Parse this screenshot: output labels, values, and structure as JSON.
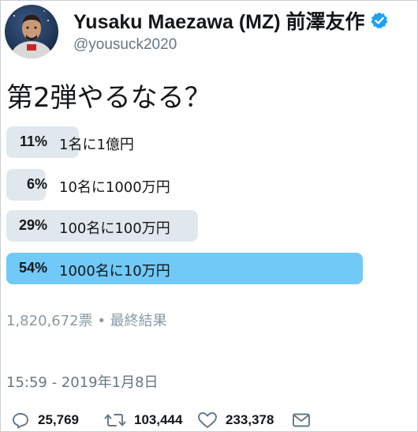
{
  "author": {
    "name": "Yusaku Maezawa (MZ) 前澤友作",
    "handle": "@yousuck2020",
    "verified": true,
    "avatar_icon": "astronaut-avatar"
  },
  "tweet": {
    "text": "第2弾やるなる？"
  },
  "poll": {
    "options": [
      {
        "percent_label": "11%",
        "percent": 11,
        "label": "1名に1億円",
        "winner": false
      },
      {
        "percent_label": "6%",
        "percent": 6,
        "label": "10名に1000万円",
        "winner": false
      },
      {
        "percent_label": "29%",
        "percent": 29,
        "label": "100名に100万円",
        "winner": false
      },
      {
        "percent_label": "54%",
        "percent": 54,
        "label": "1000名に10万円",
        "winner": true
      }
    ],
    "summary": "1,820,672票 • 最終結果"
  },
  "timestamp": "15:59 - 2019年1月8日",
  "actions": {
    "reply_icon": "reply-icon",
    "reply_count": "25,769",
    "retweet_icon": "retweet-icon",
    "retweet_count": "103,444",
    "like_icon": "heart-icon",
    "like_count": "233,378",
    "message_icon": "envelope-icon"
  },
  "colors": {
    "bar": "#e1e8ed",
    "winner_bar": "#71c9f8",
    "verified_badge": "#1da1f2",
    "muted_text": "#657786"
  }
}
